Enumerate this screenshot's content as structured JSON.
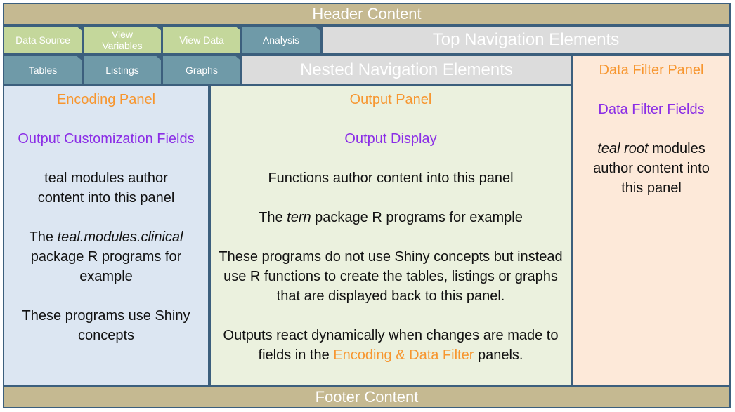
{
  "header": {
    "text": "Header Content"
  },
  "footer": {
    "text": "Footer Content"
  },
  "top_nav": {
    "tabs": [
      {
        "label": "Data Source"
      },
      {
        "label": "View Variables"
      },
      {
        "label": "View Data"
      },
      {
        "label": "Analysis"
      }
    ],
    "label": "Top Navigation Elements"
  },
  "nested_nav": {
    "tabs": [
      {
        "label": "Tables"
      },
      {
        "label": "Listings"
      },
      {
        "label": "Graphs"
      }
    ],
    "label": "Nested Navigation Elements"
  },
  "encoding_panel": {
    "title": "Encoding Panel",
    "fields": "Output Customization Fields",
    "para1": "teal modules author content into this panel",
    "para2_prefix": "The ",
    "para2_italic": "teal.modules.clinical",
    "para2_suffix": " package R programs for example",
    "para3": "These programs use Shiny concepts"
  },
  "output_panel": {
    "title": "Output Panel",
    "fields": "Output Display",
    "para1": "Functions author content into this panel",
    "para2_prefix": "The ",
    "para2_italic": "tern",
    "para2_suffix": " package R programs for example",
    "para3": "These programs do not use Shiny concepts but instead use R functions to create the tables, listings or graphs that are displayed back to this panel.",
    "para4_prefix": "Outputs react dynamically when changes are made to fields in the ",
    "para4_highlight": "Encoding & Data Filter",
    "para4_suffix": " panels."
  },
  "filter_panel": {
    "title": "Data Filter Panel",
    "fields": "Data Filter Fields",
    "para1_italic": "teal root",
    "para1_suffix": " modules author content into this panel"
  },
  "colors": {
    "frame": "#3c5f7d",
    "header_footer": "#c5b991",
    "tab_green": "#c4d79b",
    "tab_teal": "#6f9aa8",
    "encoding_bg": "#dce6f2",
    "output_bg": "#ebf1de",
    "filter_bg": "#fde9d9",
    "title_orange": "#f7962f",
    "fields_purple": "#8b2ee6"
  }
}
